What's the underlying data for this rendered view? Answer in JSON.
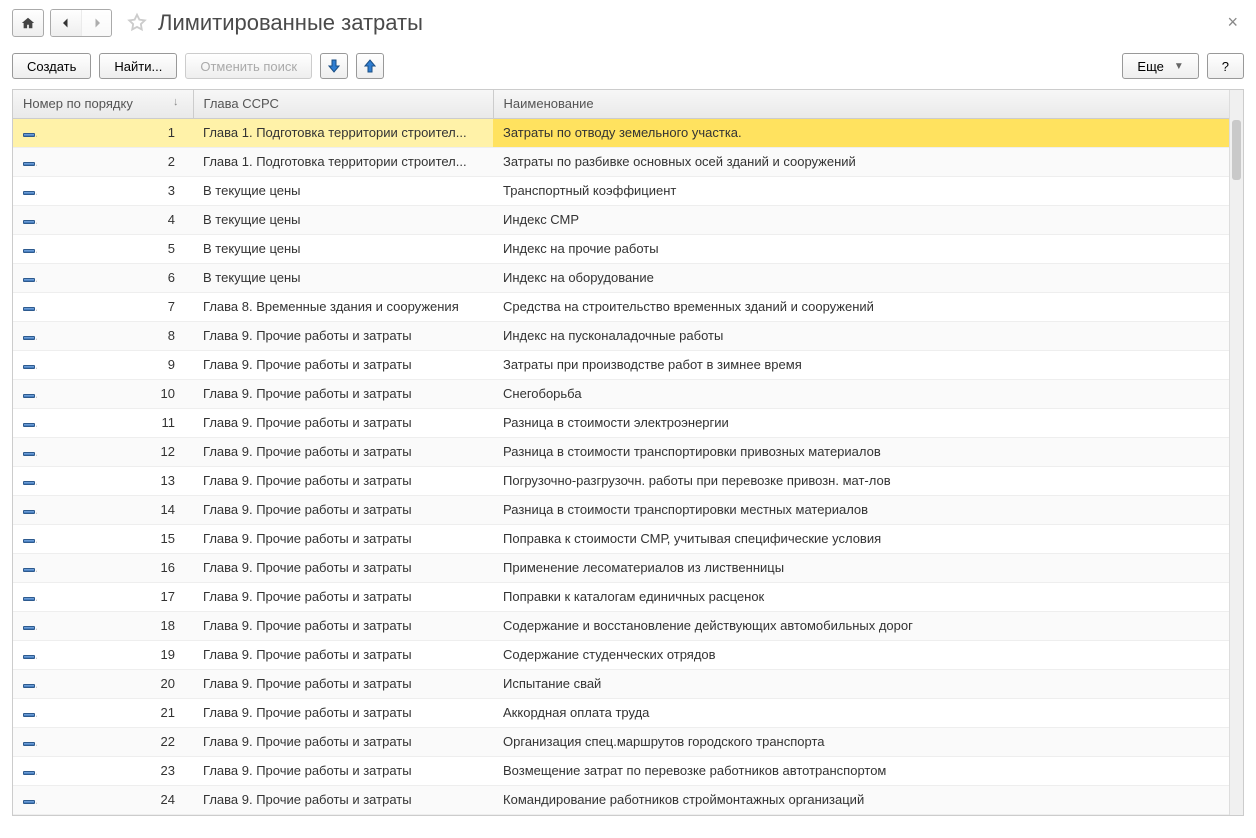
{
  "title": "Лимитированные затраты",
  "toolbar": {
    "create": "Создать",
    "find": "Найти...",
    "cancel_search": "Отменить поиск",
    "more": "Еще",
    "help": "?"
  },
  "columns": {
    "number": "Номер по порядку",
    "chapter": "Глава ССРС",
    "name": "Наименование"
  },
  "rows": [
    {
      "n": "1",
      "chapter": "Глава 1. Подготовка территории строител...",
      "name": "Затраты по отводу земельного участка.",
      "selected": true
    },
    {
      "n": "2",
      "chapter": "Глава 1. Подготовка территории строител...",
      "name": "Затраты по разбивке основных осей зданий и сооружений"
    },
    {
      "n": "3",
      "chapter": "В текущие цены",
      "name": "Транспортный коэффициент"
    },
    {
      "n": "4",
      "chapter": "В текущие цены",
      "name": "Индекс СМР"
    },
    {
      "n": "5",
      "chapter": "В текущие цены",
      "name": "Индекс на прочие работы"
    },
    {
      "n": "6",
      "chapter": "В текущие цены",
      "name": "Индекс на оборудование"
    },
    {
      "n": "7",
      "chapter": "Глава 8. Временные здания и сооружения",
      "name": "Средства на строительство временных зданий и сооружений"
    },
    {
      "n": "8",
      "chapter": "Глава 9. Прочие работы и затраты",
      "name": "Индекс на пусконаладочные работы"
    },
    {
      "n": "9",
      "chapter": "Глава 9. Прочие работы и затраты",
      "name": "Затраты при производстве работ в зимнее время"
    },
    {
      "n": "10",
      "chapter": "Глава 9. Прочие работы и затраты",
      "name": "Снегоборьба"
    },
    {
      "n": "11",
      "chapter": "Глава 9. Прочие работы и затраты",
      "name": "Разница в стоимости электроэнергии"
    },
    {
      "n": "12",
      "chapter": "Глава 9. Прочие работы и затраты",
      "name": "Разница в стоимости транспортировки привозных материалов"
    },
    {
      "n": "13",
      "chapter": "Глава 9. Прочие работы и затраты",
      "name": "Погрузочно-разгрузочн. работы при перевозке привозн. мат-лов"
    },
    {
      "n": "14",
      "chapter": "Глава 9. Прочие работы и затраты",
      "name": "Разница в стоимости транспортировки местных материалов"
    },
    {
      "n": "15",
      "chapter": "Глава 9. Прочие работы и затраты",
      "name": "Поправка к стоимости СМР, учитывая специфические условия"
    },
    {
      "n": "16",
      "chapter": "Глава 9. Прочие работы и затраты",
      "name": "Применение лесоматериалов из лиственницы"
    },
    {
      "n": "17",
      "chapter": "Глава 9. Прочие работы и затраты",
      "name": "Поправки к каталогам единичных расценок"
    },
    {
      "n": "18",
      "chapter": "Глава 9. Прочие работы и затраты",
      "name": "Содержание и восстановление действующих автомобильных дорог"
    },
    {
      "n": "19",
      "chapter": "Глава 9. Прочие работы и затраты",
      "name": "Содержание студенческих отрядов"
    },
    {
      "n": "20",
      "chapter": "Глава 9. Прочие работы и затраты",
      "name": "Испытание свай"
    },
    {
      "n": "21",
      "chapter": "Глава 9. Прочие работы и затраты",
      "name": "Аккордная оплата труда"
    },
    {
      "n": "22",
      "chapter": "Глава 9. Прочие работы и затраты",
      "name": "Организация спец.маршрутов городского транспорта"
    },
    {
      "n": "23",
      "chapter": "Глава 9. Прочие работы и затраты",
      "name": "Возмещение затрат по перевозке работников автотранспортом"
    },
    {
      "n": "24",
      "chapter": "Глава 9. Прочие работы и затраты",
      "name": "Командирование работников строймонтажных организаций"
    }
  ]
}
